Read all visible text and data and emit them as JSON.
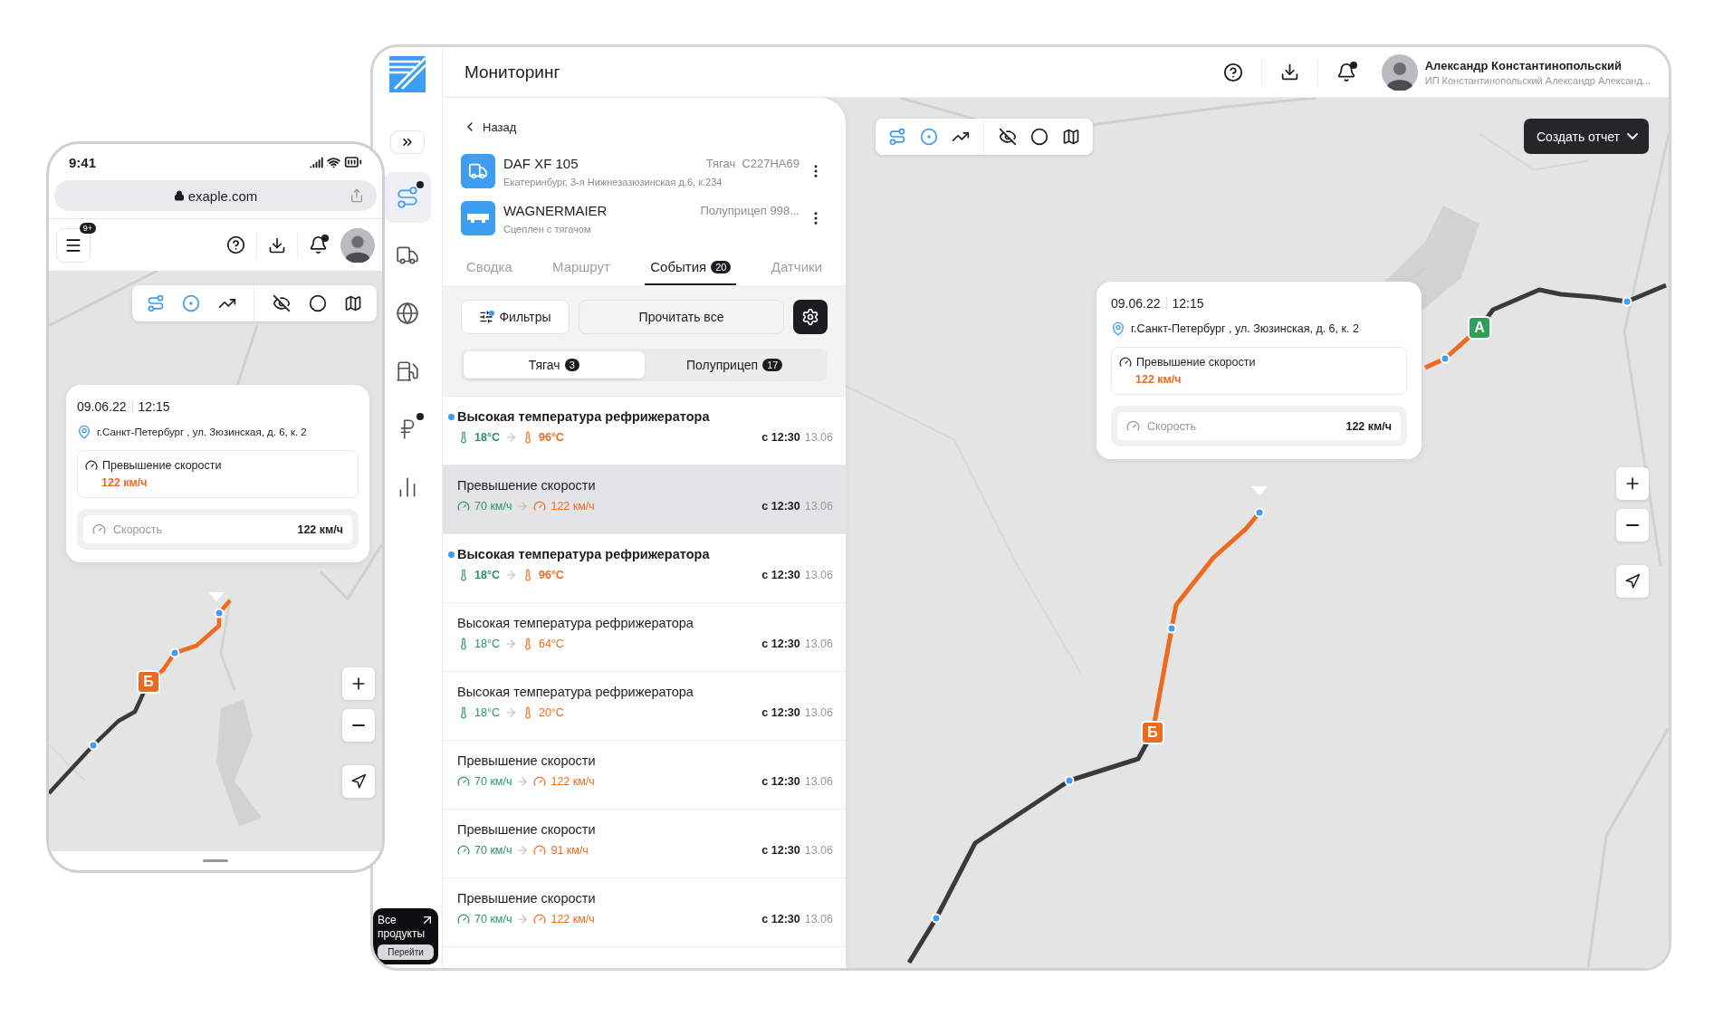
{
  "phone": {
    "status_time": "9:41",
    "url": "exaple.com",
    "menu_badge": "9+",
    "bell_dot": true,
    "toolbar": [
      {
        "kind": "route",
        "active": true
      },
      {
        "kind": "target",
        "active": true
      },
      {
        "kind": "trend",
        "active": false
      },
      {
        "kind": "hide",
        "active": false
      },
      {
        "kind": "circle",
        "active": false
      },
      {
        "kind": "map",
        "active": false
      }
    ],
    "popup": {
      "date": "09.06.22",
      "time": "12:15",
      "address": "г.Санкт-Петербург , ул. Зюзинская, д. 6, к. 2",
      "event": "Превышение скорости",
      "event_value": "122 км/ч",
      "metric": "Скорость",
      "metric_value": "122 км/ч"
    },
    "markers": [
      {
        "label": "Б",
        "kind": "finish"
      }
    ]
  },
  "app": {
    "sidebar": [
      {
        "kind": "route",
        "selected": true,
        "dot": true
      },
      {
        "kind": "truck",
        "selected": false,
        "dot": false
      },
      {
        "kind": "globe",
        "selected": false,
        "dot": false
      },
      {
        "kind": "fuel",
        "selected": false,
        "dot": false
      },
      {
        "kind": "ruble",
        "selected": false,
        "dot": true
      },
      {
        "kind": "chart",
        "selected": false,
        "dot": false
      }
    ],
    "promo": {
      "title": "Все продукты",
      "button": "Перейти"
    },
    "title": "Мониторинг",
    "bell_dot": true,
    "user": {
      "name": "Александр Константинопольский",
      "org": "ИП Константинопольский Александр Александ..."
    },
    "panel": {
      "back": "Назад",
      "vehicles": [
        {
          "kind": "truck",
          "name": "DAF XF 105",
          "info": "Тягач  С227НА69",
          "subtitle": "Екатеринбург, 3-я Нижнезазюзинская д.6, к.234"
        },
        {
          "kind": "trailer",
          "name": "WAGNERMAIER",
          "info": "Полуприцеп 998...",
          "subtitle": "Сцеплен с тягачом"
        }
      ],
      "tabs": [
        {
          "label": "Сводка",
          "selected": false
        },
        {
          "label": "Маршрут",
          "selected": false
        },
        {
          "label": "События",
          "count": "20",
          "selected": true
        },
        {
          "label": "Датчики",
          "selected": false
        }
      ],
      "filters": "Фильтры",
      "filters_dot": true,
      "read_all": "Прочитать все",
      "segments": [
        {
          "label": "Тягач",
          "count": "3",
          "selected": true
        },
        {
          "label": "Полуприцеп",
          "count": "17",
          "selected": false
        }
      ],
      "events": [
        {
          "kind": "temperature",
          "title": "Высокая температура рефрижератора",
          "from": "18°C",
          "to": "96°C",
          "time": "с 12:30",
          "date": "13.06",
          "unread": true,
          "selected": false
        },
        {
          "kind": "speed",
          "title": "Превышение скорости",
          "from": "70 км/ч",
          "to": "122 км/ч",
          "time": "с 12:30",
          "date": "13.06",
          "unread": false,
          "selected": true
        },
        {
          "kind": "temperature",
          "title": "Высокая температура рефрижератора",
          "from": "18°C",
          "to": "96°C",
          "time": "с 12:30",
          "date": "13.06",
          "unread": true,
          "selected": false
        },
        {
          "kind": "temperature",
          "title": "Высокая температура рефрижератора",
          "from": "18°C",
          "to": "64°C",
          "time": "с 12:30",
          "date": "13.06",
          "unread": false,
          "selected": false
        },
        {
          "kind": "temperature",
          "title": "Высокая температура рефрижератора",
          "from": "18°C",
          "to": "20°C",
          "time": "с 12:30",
          "date": "13.06",
          "unread": false,
          "selected": false
        },
        {
          "kind": "speed",
          "title": "Превышение скорости",
          "from": "70 км/ч",
          "to": "122 км/ч",
          "time": "с 12:30",
          "date": "13.06",
          "unread": false,
          "selected": false
        },
        {
          "kind": "speed",
          "title": "Превышение скорости",
          "from": "70 км/ч",
          "to": "91 км/ч",
          "time": "с 12:30",
          "date": "13.06",
          "unread": false,
          "selected": false
        },
        {
          "kind": "speed",
          "title": "Превышение скорости",
          "from": "70 км/ч",
          "to": "122 км/ч",
          "time": "с 12:30",
          "date": "13.06",
          "unread": false,
          "selected": false
        }
      ]
    },
    "map": {
      "toolbar": [
        {
          "kind": "route",
          "active": true
        },
        {
          "kind": "target",
          "active": true
        },
        {
          "kind": "trend",
          "active": false
        },
        {
          "kind": "hide",
          "active": false
        },
        {
          "kind": "circle",
          "active": false
        },
        {
          "kind": "map",
          "active": false
        }
      ],
      "report_button": "Создать отчет",
      "popup": {
        "date": "09.06.22",
        "time": "12:15",
        "address": "г.Санкт-Петербург , ул. Зюзинская, д. 6, к. 2",
        "event": "Превышение скорости",
        "event_value": "122 км/ч",
        "metric": "Скорость",
        "metric_value": "122 км/ч"
      },
      "markers": [
        {
          "label": "A",
          "kind": "start"
        },
        {
          "label": "Б",
          "kind": "finish"
        }
      ]
    }
  }
}
